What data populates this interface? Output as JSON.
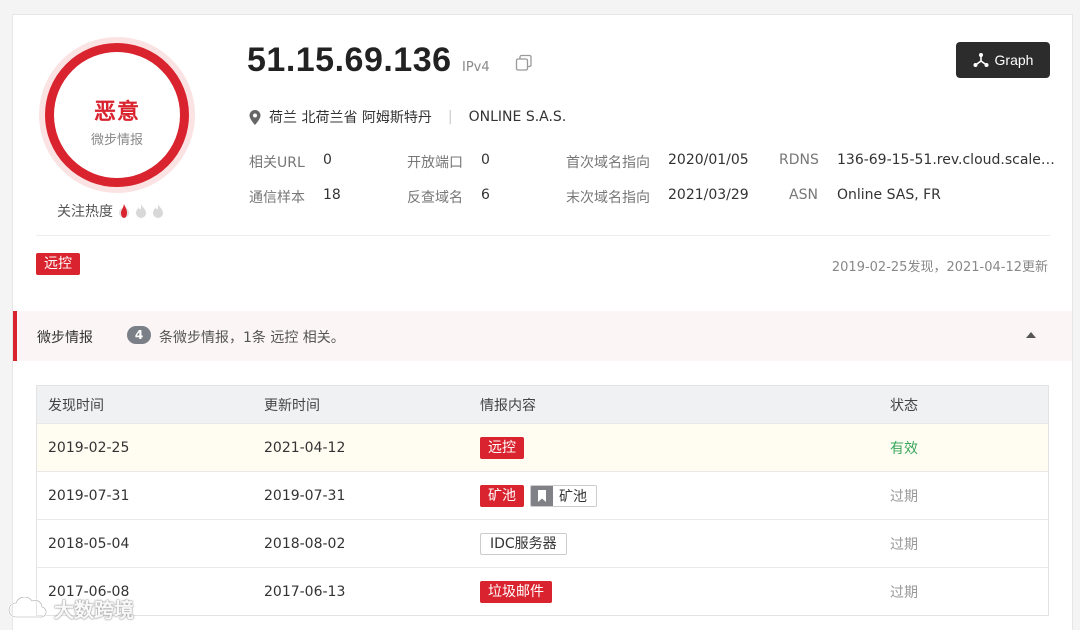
{
  "verdict": {
    "label": "恶意",
    "source": "微步情报"
  },
  "heat": {
    "label": "关注热度",
    "level": 1,
    "max": 3
  },
  "ip": {
    "address": "51.15.69.136",
    "version": "IPv4"
  },
  "graph_button": {
    "label": "Graph"
  },
  "location": {
    "place": "荷兰 北荷兰省 阿姆斯特丹",
    "org": "ONLINE S.A.S."
  },
  "meta": {
    "related_url": {
      "label": "相关URL",
      "value": "0"
    },
    "open_ports": {
      "label": "开放端口",
      "value": "0"
    },
    "first_domain": {
      "label": "首次域名指向",
      "value": "2020/01/05"
    },
    "rdns": {
      "label": "RDNS",
      "value": "136-69-15-51.rev.cloud.scale…"
    },
    "samples": {
      "label": "通信样本",
      "value": "18"
    },
    "reverse_domains": {
      "label": "反查域名",
      "value": "6"
    },
    "last_domain": {
      "label": "末次域名指向",
      "value": "2021/03/29"
    },
    "asn": {
      "label": "ASN",
      "value": "Online SAS, FR"
    }
  },
  "tags": [
    "远控"
  ],
  "found_text": "2019-02-25发现，2021-04-12更新",
  "intel": {
    "title": "微步情报",
    "count": "4",
    "desc": "条微步情报，1条 远控 相关。",
    "columns": [
      "发现时间",
      "更新时间",
      "情报内容",
      "状态"
    ],
    "rows": [
      {
        "found": "2019-02-25",
        "updated": "2021-04-12",
        "tags": [
          "远控"
        ],
        "status": "有效"
      },
      {
        "found": "2019-07-31",
        "updated": "2019-07-31",
        "tags": [
          "矿池",
          "矿池"
        ],
        "status": "过期"
      },
      {
        "found": "2018-05-04",
        "updated": "2018-08-02",
        "tags": [
          "IDC服务器"
        ],
        "status": "过期"
      },
      {
        "found": "2017-06-08",
        "updated": "2017-06-13",
        "tags": [
          "垃圾邮件"
        ],
        "status": "过期"
      }
    ]
  },
  "watermark": "大数跨境",
  "colors": {
    "accent_red": "#d9232e",
    "valid_green": "#3aa85c",
    "button_dark": "#2c2c2c"
  }
}
